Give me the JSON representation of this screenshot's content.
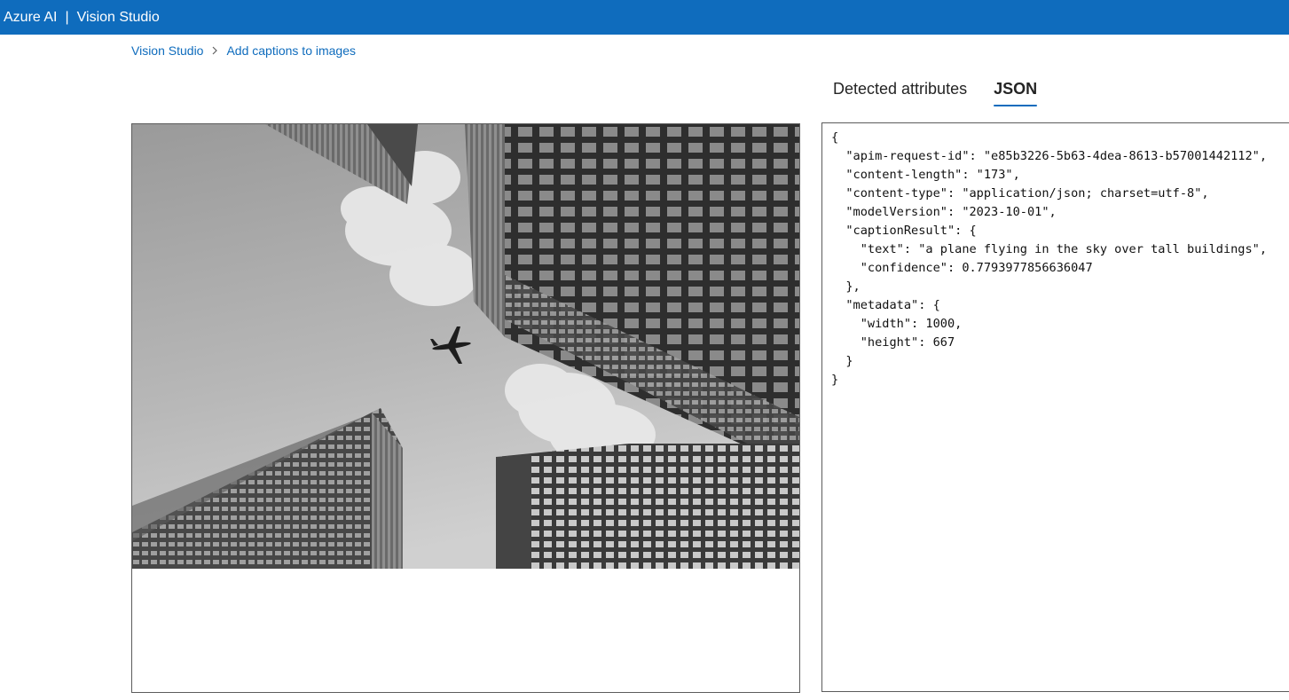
{
  "topbar": {
    "brand": "Azure AI",
    "separator": "|",
    "app_name": "Vision Studio"
  },
  "breadcrumb": {
    "items": [
      "Vision Studio",
      "Add captions to images"
    ]
  },
  "tabs": [
    {
      "label": "Detected attributes",
      "active": false
    },
    {
      "label": "JSON",
      "active": true
    }
  ],
  "image": {
    "icon": "sample-photo-skyscrapers-airplane"
  },
  "json_output": {
    "lines": [
      "{",
      "  \"apim-request-id\": \"e85b3226-5b63-4dea-8613-b57001442112\",",
      "  \"content-length\": \"173\",",
      "  \"content-type\": \"application/json; charset=utf-8\",",
      "  \"modelVersion\": \"2023-10-01\",",
      "  \"captionResult\": {",
      "    \"text\": \"a plane flying in the sky over tall buildings\",",
      "    \"confidence\": 0.7793977856636047",
      "  },",
      "  \"metadata\": {",
      "    \"width\": 1000,",
      "    \"height\": 667",
      "  }",
      "}"
    ]
  },
  "colors": {
    "accent": "#0f6cbd",
    "border": "#5c5c5c"
  }
}
